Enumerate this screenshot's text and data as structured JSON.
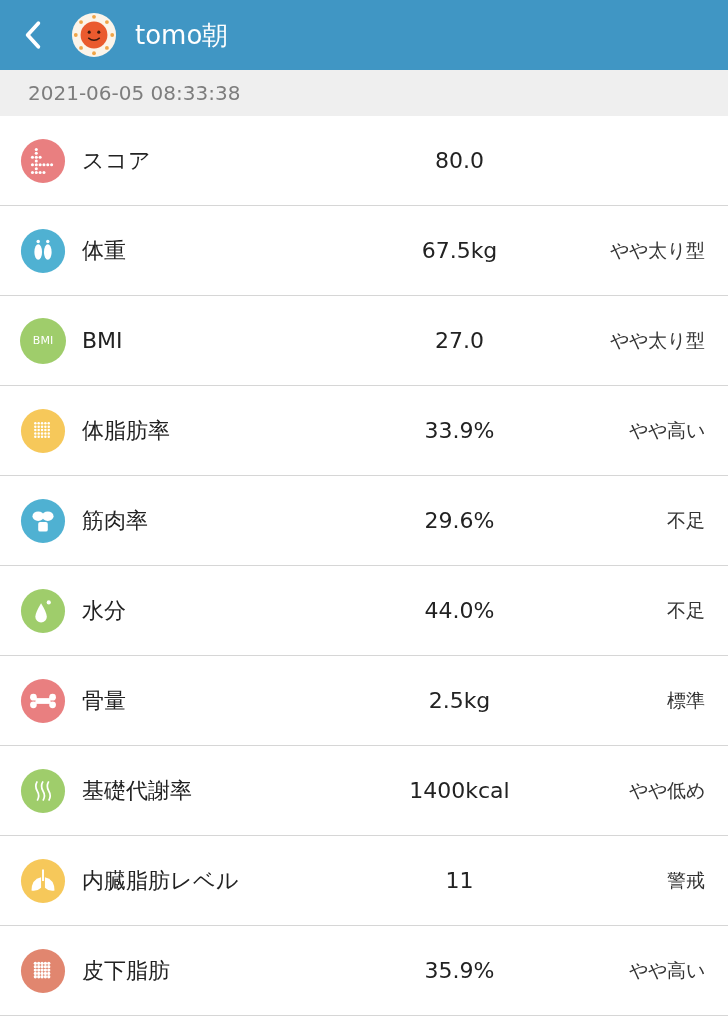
{
  "header": {
    "title": "tomo朝"
  },
  "date_bar": {
    "text": "2021-06-05 08:33:38"
  },
  "rows": [
    {
      "kind": "score",
      "color": "#e97f80",
      "label": "スコア",
      "value": "80.0"
    },
    {
      "kind": "feet",
      "color": "#4fb1d2",
      "label": "体重",
      "value": "67.5kg",
      "rating": "やや太り型"
    },
    {
      "kind": "badge",
      "color": "#9fcd6b",
      "badge": "BMI",
      "label": "BMI",
      "value": "27.0",
      "rating": "やや太り型"
    },
    {
      "kind": "grid",
      "color": "#f6c85a",
      "label": "体脂肪率",
      "value": "33.9%",
      "rating": "やや高い"
    },
    {
      "kind": "muscle",
      "color": "#4fb1d2",
      "label": "筋肉率",
      "value": "29.6%",
      "rating": "不足"
    },
    {
      "kind": "drop",
      "color": "#9fcd6b",
      "label": "水分",
      "value": "44.0%",
      "rating": "不足"
    },
    {
      "kind": "bone",
      "color": "#e97f80",
      "label": "骨量",
      "value": "2.5kg",
      "rating": "標準"
    },
    {
      "kind": "heat",
      "color": "#9fcd6b",
      "label": "基礎代謝率",
      "value": "1400kcal",
      "rating": "やや低め"
    },
    {
      "kind": "lungs",
      "color": "#f6c85a",
      "label": "内臓脂肪レベル",
      "value": "11",
      "rating": "警戒"
    },
    {
      "kind": "mesh",
      "color": "#e1866f",
      "label": "皮下脂肪",
      "value": "35.9%",
      "rating": "やや高い"
    }
  ]
}
